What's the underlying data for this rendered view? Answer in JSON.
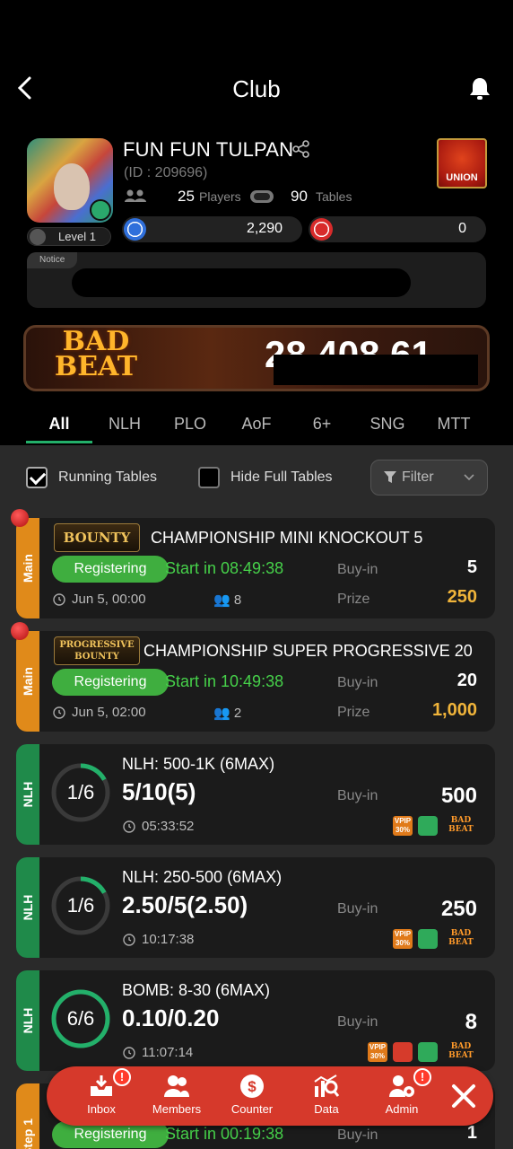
{
  "header": {
    "title": "Club"
  },
  "club": {
    "name": "FUN FUN TULPAN",
    "id_text": "(ID : 209696)",
    "players_count": "25",
    "players_label": "Players",
    "tables_count": "90",
    "tables_label": "Tables",
    "level": "Level 1",
    "union_label": "UNION",
    "chips_blue": "2,290",
    "chips_red": "0"
  },
  "notice": {
    "tag": "Notice"
  },
  "banner": {
    "logo_line1": "BAD",
    "logo_line2": "BEAT",
    "jackpot_visible": "28,408.61"
  },
  "tabs": [
    {
      "label": "All",
      "active": true
    },
    {
      "label": "NLH"
    },
    {
      "label": "PLO"
    },
    {
      "label": "AoF"
    },
    {
      "label": "6+"
    },
    {
      "label": "SNG"
    },
    {
      "label": "MTT"
    }
  ],
  "filters": {
    "running_tables": "Running Tables",
    "hide_full_tables": "Hide Full Tables",
    "filter_label": "Filter"
  },
  "tournaments": [
    {
      "side": "Main",
      "logo": "BOUNTY",
      "name": "CHAMPIONSHIP MINI KNOCKOUT 5",
      "status": "Registering",
      "start": "Start in 08:49:38",
      "date": "Jun 5, 00:00",
      "players": "8",
      "buyin_label": "Buy-in",
      "buyin": "5",
      "prize_label": "Prize",
      "prize": "250"
    },
    {
      "side": "Main",
      "logo": "PROGRESSIVE BOUNTY",
      "name": "CHAMPIONSHIP SUPER PROGRESSIVE 20",
      "status": "Registering",
      "start": "Start in 10:49:38",
      "date": "Jun 5, 02:00",
      "players": "2",
      "buyin_label": "Buy-in",
      "buyin": "20",
      "prize_label": "Prize",
      "prize": "1,000"
    }
  ],
  "tables": [
    {
      "side": "NLH",
      "seats": "1/6",
      "fill": 0.17,
      "game": "NLH: 500-1K (6MAX)",
      "blinds": "5/10(5)",
      "time": "05:33:52",
      "buyin_label": "Buy-in",
      "buyin": "500",
      "vpip": "VPIP 30%",
      "badbeat": "BAD BEAT",
      "bomb": false
    },
    {
      "side": "NLH",
      "seats": "1/6",
      "fill": 0.17,
      "game": "NLH: 250-500 (6MAX)",
      "blinds": "2.50/5(2.50)",
      "time": "10:17:38",
      "buyin_label": "Buy-in",
      "buyin": "250",
      "vpip": "VPIP 30%",
      "badbeat": "BAD BEAT",
      "bomb": false
    },
    {
      "side": "NLH",
      "seats": "6/6",
      "fill": 1.0,
      "game": "BOMB: 8-30 (6MAX)",
      "blinds": "0.10/0.20",
      "time": "11:07:14",
      "buyin_label": "Buy-in",
      "buyin": "8",
      "vpip": "VPIP 30%",
      "badbeat": "BAD BEAT",
      "bomb": true
    }
  ],
  "partial_card": {
    "side": "Step 1",
    "status": "Registering",
    "start": "Start in 00:19:38",
    "buyin_label": "Buy-in",
    "buyin": "1"
  },
  "bottom_nav": [
    {
      "label": "Inbox",
      "icon": "inbox-icon",
      "alert": "!"
    },
    {
      "label": "Members",
      "icon": "members-icon"
    },
    {
      "label": "Counter",
      "icon": "dollar-icon"
    },
    {
      "label": "Data",
      "icon": "data-icon"
    },
    {
      "label": "Admin",
      "icon": "admin-icon",
      "alert": "!"
    }
  ],
  "colors": {
    "accent_green": "#23b06a",
    "nav_red": "#d6392b",
    "prize_gold": "#f0b43a",
    "start_green": "#46d14a"
  }
}
